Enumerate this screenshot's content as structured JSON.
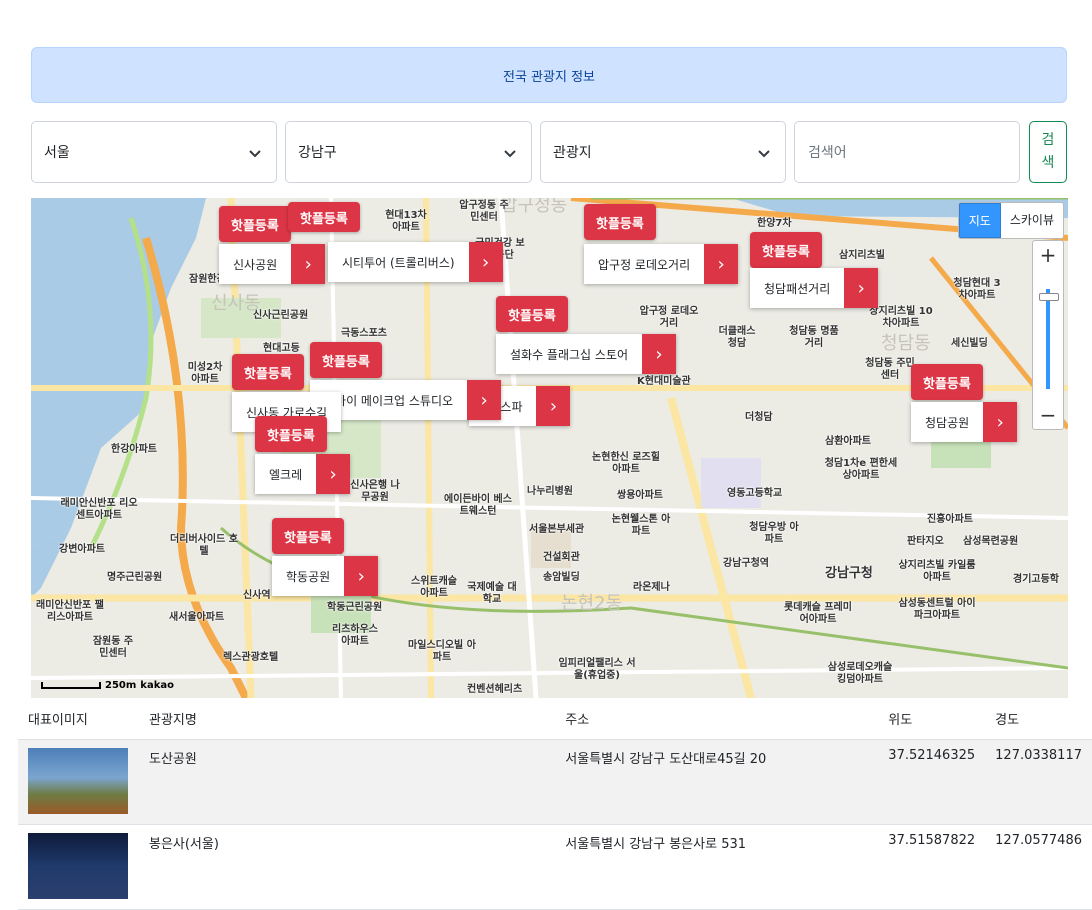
{
  "banner": {
    "title": "전국 관광지 정보"
  },
  "filters": {
    "region": "서울",
    "district": "강남구",
    "category": "관광지",
    "search_placeholder": "검색어",
    "search_button": "검\n색"
  },
  "map": {
    "type_toggle": {
      "map": "지도",
      "skyview": "스카이뷰"
    },
    "zoom_in": "+",
    "zoom_out": "−",
    "scale_text": "250m",
    "logo": "kakao",
    "hot_label": "핫플등록",
    "markers": [
      {
        "name": "신사공원"
      },
      {
        "name": "시티투어 (트롤리버스)"
      },
      {
        "name": "압구정 로데오거리"
      },
      {
        "name": "청담패션거리"
      },
      {
        "name": "설화수 플래그십 스토어"
      },
      {
        "name": "립바이 메이크업 스튜디오"
      },
      {
        "name": "신사동 가로수길"
      },
      {
        "name": "HC스파"
      },
      {
        "name": "청담공원"
      },
      {
        "name": "엘크레"
      },
      {
        "name": "학동공원"
      }
    ],
    "labels": [
      "압구정동 주민센터",
      "현대13차 아파트",
      "국민건강 보험공단",
      "한양7차",
      "삼지리츠빌",
      "잠원한강",
      "청담현대 3차아파트",
      "신사근린공원",
      "극동스포츠",
      "현대고등",
      "압구정 로데오거리",
      "더클래스 청담",
      "청담동 명품거리",
      "상지리츠빌 10차아파트",
      "세신빌딩",
      "청담동 주민센터",
      "미성2차 아파트",
      "K현대미술관",
      "더청담",
      "한강아파트",
      "삼환아파트",
      "논현한신 로즈힐아파트",
      "청담1차e 편한세상아파트",
      "나누리병원",
      "쌍용아파트",
      "영동고등학교",
      "신사은행 나무공원",
      "에이든바이 베스트웨스턴",
      "서울본부세관",
      "논현웰스톤 아파트",
      "청담우방 아파트",
      "진흥아파트",
      "더리버사이드 호텔",
      "건설회관",
      "강남구청역",
      "강남구청",
      "판타지오",
      "삼성목련공원",
      "명주근린공원",
      "송암빌딩",
      "라온제나",
      "상지리츠빌 카일룸아파트",
      "경기고등학",
      "스위트캐슬 아파트",
      "국제예술 대학교",
      "신사역",
      "학동근린공원",
      "롯데캐슬 프레미어아파트",
      "삼성동센트럴 아이파크아파트",
      "래미안신반포 팰리스아파트",
      "새서울아파트",
      "리츠하우스 아파트",
      "잠원동 주민센터",
      "렉스관광호텔",
      "마일스디오빌 아파트",
      "임피리얼팰리스 서울(휴업중)",
      "삼성로데오캐슬 킹덤아파트",
      "컨벤션헤리츠",
      "래미안신반포 리오센트아파트",
      "강변아파트",
      "신사동",
      "압구정동",
      "논현2동",
      "청담동"
    ]
  },
  "table": {
    "headers": [
      "대표이미지",
      "관광지명",
      "주소",
      "위도",
      "경도"
    ],
    "rows": [
      {
        "name": "도산공원",
        "address": "서울특별시 강남구 도산대로45길 20",
        "lat": "37.52146325",
        "lng": "127.0338117"
      },
      {
        "name": "봉은사(서울)",
        "address": "서울특별시 강남구 봉은사로 531",
        "lat": "37.51587822",
        "lng": "127.0577486"
      }
    ]
  }
}
